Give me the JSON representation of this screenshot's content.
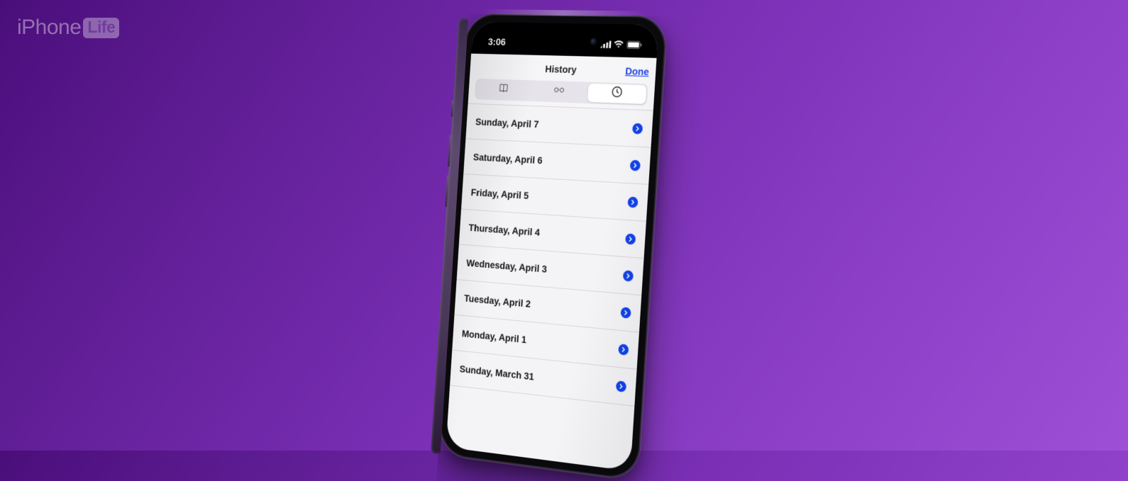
{
  "watermark": {
    "brand": "iPhone",
    "sub": "Life"
  },
  "status": {
    "time": "3:06"
  },
  "header": {
    "title": "History",
    "done": "Done"
  },
  "tabs": {
    "bookmarks": "bookmarks-icon",
    "reading": "reading-list-icon",
    "history": "history-icon",
    "activeIndex": 2
  },
  "history": [
    {
      "label": "Sunday, April 7"
    },
    {
      "label": "Saturday, April 6"
    },
    {
      "label": "Friday, April 5"
    },
    {
      "label": "Thursday, April 4"
    },
    {
      "label": "Wednesday, April 3"
    },
    {
      "label": "Tuesday, April 2"
    },
    {
      "label": "Monday, April 1"
    },
    {
      "label": "Sunday, March 31"
    }
  ]
}
